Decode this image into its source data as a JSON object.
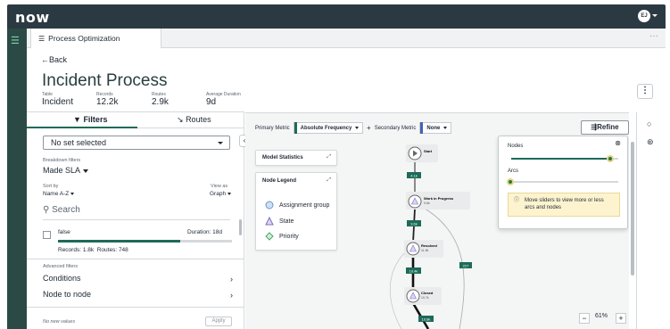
{
  "app": {
    "logo": "now",
    "avatar_initials": "EJ"
  },
  "tab": {
    "title": "Process Optimization"
  },
  "header": {
    "back_label": "←Back",
    "title": "Incident Process",
    "meta": [
      {
        "label": "Table",
        "value": "Incident"
      },
      {
        "label": "Records",
        "value": "12.2k"
      },
      {
        "label": "Routes",
        "value": "2.9k"
      },
      {
        "label": "Average Duration",
        "value": "9d"
      }
    ]
  },
  "left_panel": {
    "tabs": {
      "filters": "Filters",
      "routes": "Routes"
    },
    "set_select": "No set selected",
    "breakdown_label": "Breakdown filters",
    "breakdown_value": "Made SLA",
    "sort_label": "Sort by",
    "sort_value": "Name A-Z",
    "view_label": "View as",
    "view_value": "Graph",
    "search_placeholder": "Search",
    "row": {
      "name": "false",
      "duration": "Duration: 18d",
      "records": "Records: 1.8k",
      "routes": "Routes: 748",
      "progress": 0.7
    },
    "advanced_label": "Advanced filters",
    "conditions_label": "Conditions",
    "node_to_node_label": "Node to node",
    "no_new_values": "No new values",
    "apply_label": "Apply"
  },
  "toolbar": {
    "primary_label": "Primary Metric",
    "primary_value": "Absolute Frequency",
    "primary_color": "#1d6b58",
    "plus": "+",
    "secondary_label": "Secondary Metric",
    "secondary_value": "None",
    "secondary_color": "#4b5fb4",
    "refine_label": "Refine"
  },
  "model_stats": {
    "title": "Model Statistics"
  },
  "legend": {
    "title": "Node Legend",
    "items": [
      {
        "label": "Assignment group",
        "icon": "circle-icon"
      },
      {
        "label": "State",
        "icon": "triangle-icon"
      },
      {
        "label": "Priority",
        "icon": "diamond-icon"
      }
    ]
  },
  "graph_nodes": [
    {
      "name": "Start",
      "count": ""
    },
    {
      "name": "Work in Progress",
      "count": "9.6k"
    },
    {
      "name": "Resolved",
      "count": "11.9k"
    },
    {
      "name": "Closed",
      "count": "10.7k"
    }
  ],
  "graph_edges": [
    "4.1k",
    "3.6k",
    "10.4k",
    "227",
    "10.6k"
  ],
  "refine_popup": {
    "nodes_label": "Nodes",
    "nodes_level": 0.93,
    "arcs_label": "Arcs",
    "arcs_level": 0.0,
    "info_text": "Move sliders to view more or less arcs and nodes"
  },
  "zoom": {
    "minus": "−",
    "value": "61%",
    "plus": "+"
  }
}
